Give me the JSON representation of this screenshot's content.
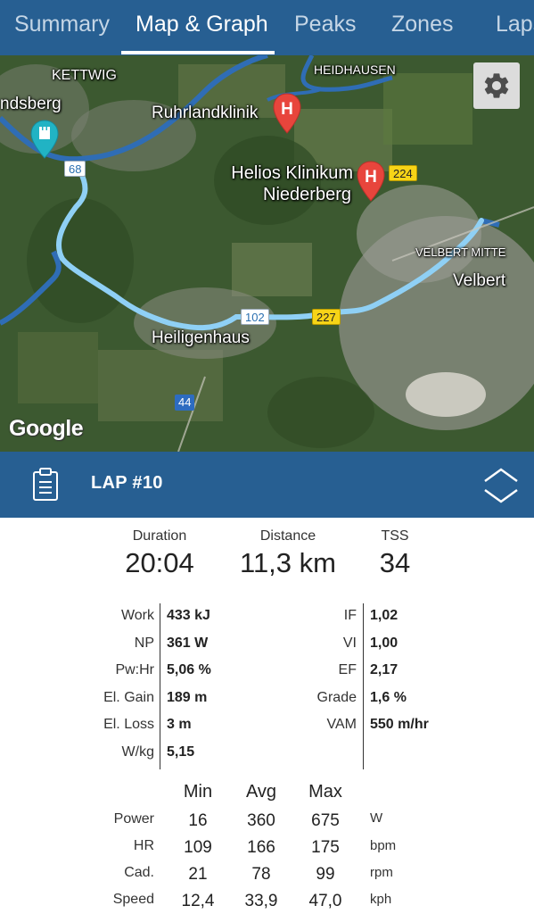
{
  "tabs": [
    {
      "label": "Summary",
      "active": false
    },
    {
      "label": "Map & Graph",
      "active": true
    },
    {
      "label": "Peaks",
      "active": false
    },
    {
      "label": "Zones",
      "active": false
    },
    {
      "label": "Laps",
      "active": false
    }
  ],
  "map": {
    "labels": {
      "kettwig": "KETTWIG",
      "heidhausen": "HEIDHAUSEN",
      "landsberg": "ndsberg",
      "ruhrlandklinik": "Ruhrlandklinik",
      "helios_line1": "Helios Klinikum",
      "helios_line2": "Niederberg",
      "velbert_mitte": "VELBERT MITTE",
      "velbert": "Velbert",
      "heiligenhaus": "Heiligenhaus"
    },
    "road_badges": {
      "r68": "68",
      "r224": "224",
      "r102": "102",
      "r227": "227",
      "r44": "44"
    },
    "hospital_pin_letter": "H",
    "attribution": "Google",
    "settings_icon": "gear-icon",
    "route_color": "#8fd0f5",
    "river_color": "#2f6db5"
  },
  "lap": {
    "title": "LAP #10",
    "icon": "clipboard-icon",
    "toggle_icon": "chevron-up-down-icon"
  },
  "summary": {
    "duration_label": "Duration",
    "duration_value": "20:04",
    "distance_label": "Distance",
    "distance_value": "11,3 km",
    "tss_label": "TSS",
    "tss_value": "34"
  },
  "stats_left": [
    {
      "label": "Work",
      "value": "433 kJ"
    },
    {
      "label": "NP",
      "value": "361 W"
    },
    {
      "label": "Pw:Hr",
      "value": "5,06 %"
    },
    {
      "label": "El. Gain",
      "value": "189 m"
    },
    {
      "label": "El. Loss",
      "value": "3 m"
    },
    {
      "label": "W/kg",
      "value": "5,15"
    }
  ],
  "stats_right": [
    {
      "label": "IF",
      "value": "1,02"
    },
    {
      "label": "VI",
      "value": "1,00"
    },
    {
      "label": "EF",
      "value": "2,17"
    },
    {
      "label": "Grade",
      "value": "1,6 %"
    },
    {
      "label": "VAM",
      "value": "550 m/hr"
    }
  ],
  "minmax": {
    "headers": {
      "min": "Min",
      "avg": "Avg",
      "max": "Max"
    },
    "rows": [
      {
        "label": "Power",
        "min": "16",
        "avg": "360",
        "max": "675",
        "unit": "W"
      },
      {
        "label": "HR",
        "min": "109",
        "avg": "166",
        "max": "175",
        "unit": "bpm"
      },
      {
        "label": "Cad.",
        "min": "21",
        "avg": "78",
        "max": "99",
        "unit": "rpm"
      },
      {
        "label": "Speed",
        "min": "12,4",
        "avg": "33,9",
        "max": "47,0",
        "unit": "kph"
      }
    ]
  },
  "colors": {
    "header_blue": "#275f92",
    "tab_inactive": "#c5d6e6",
    "pin_red": "#e8453c"
  }
}
